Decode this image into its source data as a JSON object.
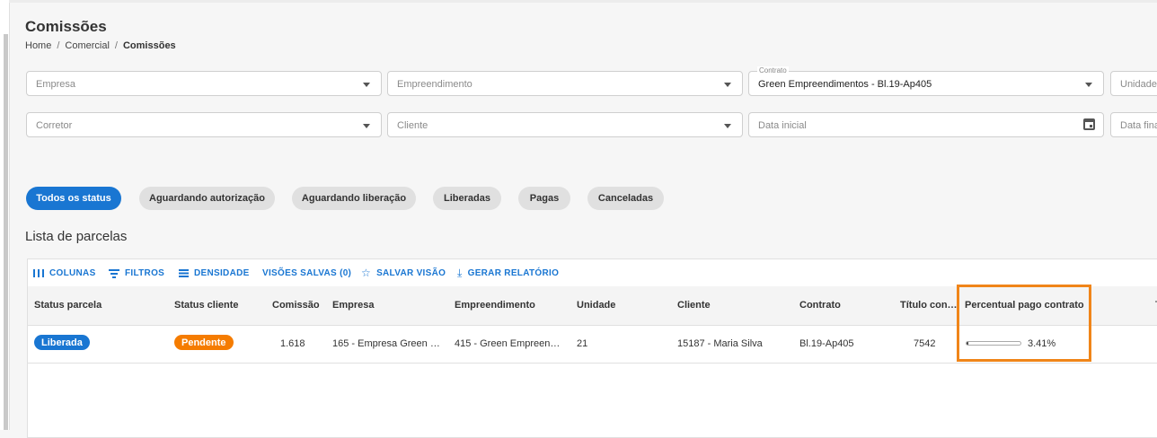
{
  "page": {
    "title": "Comissões",
    "breadcrumb": [
      "Home",
      "Comercial",
      "Comissões"
    ]
  },
  "filters": {
    "empresa": "Empresa",
    "empreendimento": "Empreendimento",
    "contrato_label": "Contrato",
    "contrato_value": "Green Empreendimentos - Bl.19-Ap405",
    "unidade": "Unidade",
    "corretor": "Corretor",
    "cliente": "Cliente",
    "data_inicial": "Data inicial",
    "data_final": "Data fina"
  },
  "status_chips": [
    {
      "label": "Todos os status",
      "active": true
    },
    {
      "label": "Aguardando autorização"
    },
    {
      "label": "Aguardando liberação"
    },
    {
      "label": "Liberadas"
    },
    {
      "label": "Pagas"
    },
    {
      "label": "Canceladas"
    }
  ],
  "section_title": "Lista de parcelas",
  "toolbar": {
    "colunas": "COLUNAS",
    "filtros": "FILTROS",
    "densidade": "DENSIDADE",
    "visoes": "VISÕES SALVAS (0)",
    "salvar": "SALVAR VISÃO",
    "relatorio": "GERAR RELATÓRIO"
  },
  "table": {
    "headers": [
      "Status parcela",
      "Status cliente",
      "Comissão",
      "Empresa",
      "Empreendimento",
      "Unidade",
      "Cliente",
      "Contrato",
      "Título con…",
      "Percentual pago contrato"
    ],
    "rows": [
      {
        "status_parcela": "Liberada",
        "status_cliente": "Pendente",
        "comissao": "1.618",
        "empresa": "165 - Empresa Green …",
        "empreendimento": "415 - Green Empreen…",
        "unidade": "21",
        "cliente": "15187 - Maria Silva",
        "contrato": "Bl.19-Ap405",
        "titulo": "7542",
        "percentual": "3.41%",
        "percentual_value": 0.0341
      }
    ]
  },
  "colors": {
    "primary": "#1976d2",
    "liberada": "#1976d2",
    "pendente": "#f57c00",
    "highlight": "#f08519"
  }
}
